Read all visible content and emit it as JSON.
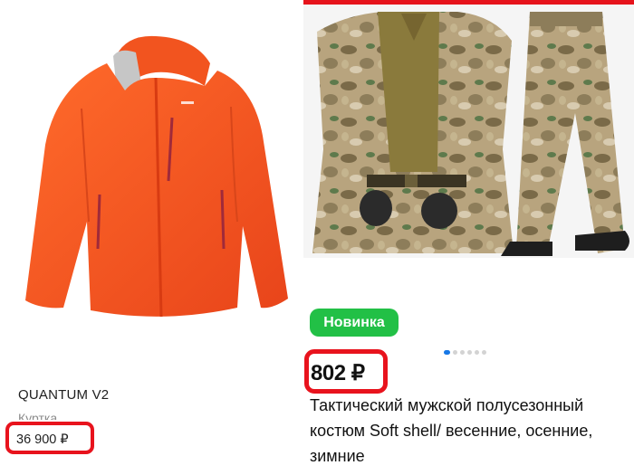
{
  "left_product": {
    "name": "QUANTUM V2",
    "category": "Куртка",
    "price": "36 900 ₽",
    "image_icon": "orange-jacket-image"
  },
  "right_product": {
    "badge": "Новинка",
    "price": "802 ₽",
    "title": "Тактический мужской полусезонный костюм Soft shell/ весенние, осенние, зимние",
    "image_icon": "camouflage-suit-image",
    "carousel": {
      "total": 6,
      "active": 1
    }
  },
  "colors": {
    "highlight": "#e8131d",
    "badge_green": "#22c046",
    "jacket_orange": "#f4511e",
    "accent_bar": "#e6131b"
  }
}
